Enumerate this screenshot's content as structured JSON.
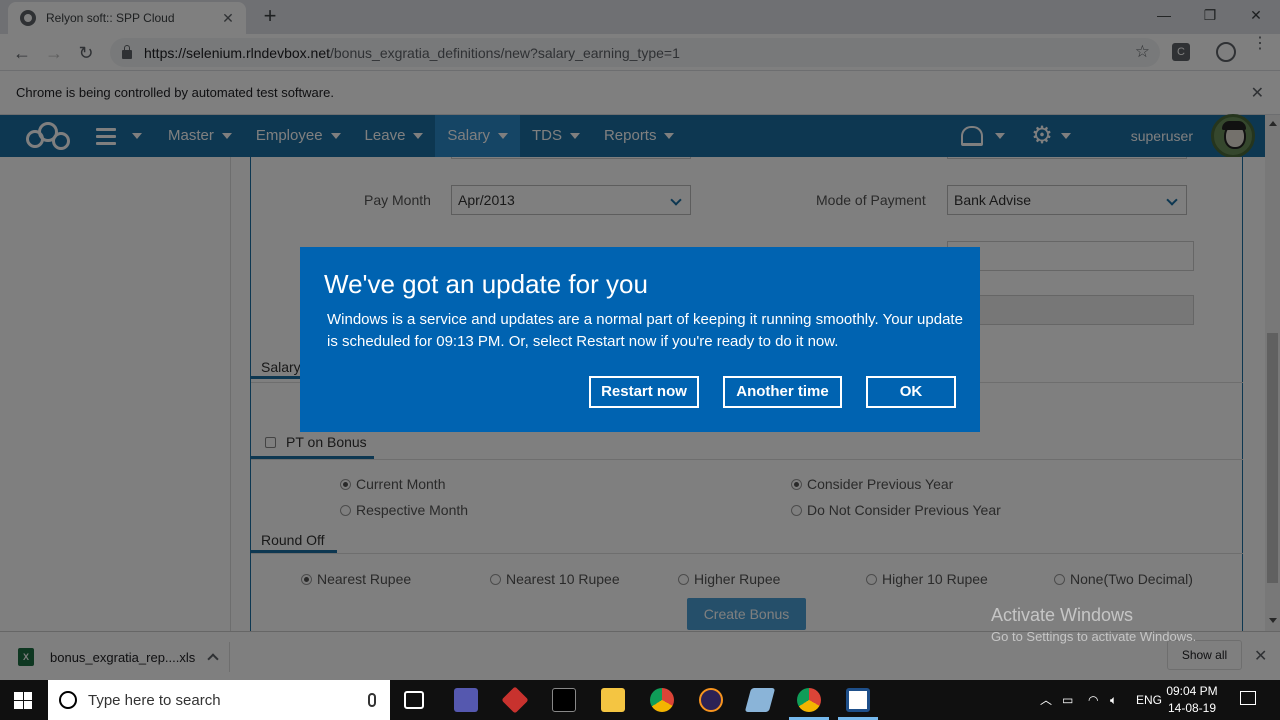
{
  "browser": {
    "tab_title": "Relyon soft:: SPP Cloud",
    "url_host": "https://selenium.rlndevbox.net",
    "url_path": "/bonus_exgratia_definitions/new?salary_earning_type=1",
    "infobar_text": "Chrome is being controlled by automated test software."
  },
  "nav": {
    "items": [
      {
        "label": "Master"
      },
      {
        "label": "Employee"
      },
      {
        "label": "Leave"
      },
      {
        "label": "Salary",
        "active": true
      },
      {
        "label": "TDS"
      },
      {
        "label": "Reports"
      }
    ],
    "username": "superuser"
  },
  "form": {
    "pay_month_label": "Pay Month",
    "pay_month_value": "Apr/2013",
    "mode_of_payment_label": "Mode of Payment",
    "mode_of_payment_value": "Bank Advise",
    "salary_tab_label": "Salary",
    "pt_on_bonus_label": "PT on Bonus",
    "pt_on_bonus_checked": false,
    "month_options": [
      {
        "label": "Current Month",
        "selected": true
      },
      {
        "label": "Respective Month",
        "selected": false
      }
    ],
    "year_options": [
      {
        "label": "Consider Previous Year",
        "selected": true
      },
      {
        "label": "Do Not Consider Previous Year",
        "selected": false
      }
    ],
    "round_off_label": "Round Off",
    "round_off_options": [
      {
        "label": "Nearest Rupee",
        "selected": true
      },
      {
        "label": "Nearest 10 Rupee",
        "selected": false
      },
      {
        "label": "Higher Rupee",
        "selected": false
      },
      {
        "label": "Higher 10 Rupee",
        "selected": false
      },
      {
        "label": "None(Two Decimal)",
        "selected": false
      }
    ],
    "create_button": "Create Bonus"
  },
  "dialog": {
    "title": "We've got an update for you",
    "message": "Windows is a service and updates are a normal part of keeping it running smoothly. Your update is scheduled for 09:13 PM. Or, select Restart now if you're ready to do it now.",
    "restart_label": "Restart now",
    "another_time_label": "Another time",
    "ok_label": "OK",
    "background_color": "#0063b1"
  },
  "watermark": {
    "line1": "Activate Windows",
    "line2": "Go to Settings to activate Windows."
  },
  "downloads": {
    "file_name": "bonus_exgratia_rep....xls",
    "show_all": "Show all"
  },
  "taskbar": {
    "search_placeholder": "Type here to search",
    "language": "ENG",
    "time": "09:04 PM",
    "date": "14-08-19"
  },
  "colors": {
    "nav_blue": "#1a6fa3",
    "accent": "#2a8acb"
  }
}
